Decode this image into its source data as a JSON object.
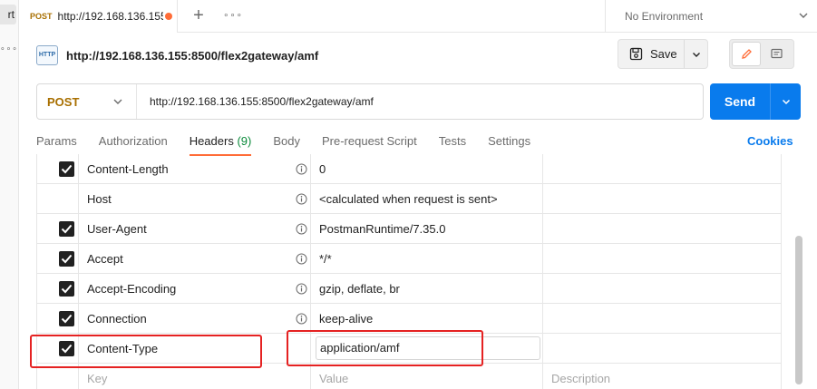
{
  "sidebar": {
    "collapsed_label": "rt",
    "more": "∘∘∘"
  },
  "tabbar": {
    "tab": {
      "method": "POST",
      "title": "http://192.168.136.155"
    },
    "new_tab": "+",
    "more": "∘∘∘",
    "environment": "No Environment"
  },
  "request": {
    "title": "http://192.168.136.155:8500/flex2gateway/amf",
    "icon_text": "HTTP",
    "save_label": "Save",
    "method": "POST",
    "url": "http://192.168.136.155:8500/flex2gateway/amf",
    "send_label": "Send"
  },
  "req_tabs": {
    "params": "Params",
    "authorization": "Authorization",
    "headers": "Headers",
    "headers_count": "(9)",
    "body": "Body",
    "prerequest": "Pre-request Script",
    "tests": "Tests",
    "settings": "Settings",
    "cookies": "Cookies"
  },
  "headers": {
    "rows": [
      {
        "key": "Content-Length",
        "value": "0",
        "checked": true
      },
      {
        "key": "Host",
        "value": "<calculated when request is sent>",
        "checked": false
      },
      {
        "key": "User-Agent",
        "value": "PostmanRuntime/7.35.0",
        "checked": true
      },
      {
        "key": "Accept",
        "value": "*/*",
        "checked": true
      },
      {
        "key": "Accept-Encoding",
        "value": "gzip, deflate, br",
        "checked": true
      },
      {
        "key": "Connection",
        "value": "keep-alive",
        "checked": true
      },
      {
        "key": "Content-Type",
        "value": "application/amf",
        "checked": true
      }
    ],
    "placeholder": {
      "key": "Key",
      "value": "Value",
      "description": "Description"
    }
  },
  "colors": {
    "accent": "#ff6c37",
    "send": "#097bed",
    "method": "#a86f00",
    "highlight": "#e52222"
  }
}
